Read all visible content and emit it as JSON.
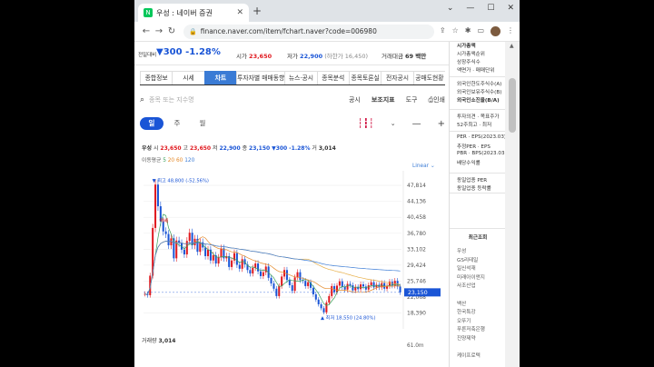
{
  "browser": {
    "tab_title": "우성 : 네이버 증권",
    "url": "finance.naver.com/item/fchart.naver?code=006980"
  },
  "price_bar": {
    "prev_label": "전일대비",
    "change": "▼300",
    "change_pct": "-1.28%",
    "open_label": "시가",
    "open": "23,650",
    "low_label": "저가",
    "low": "22,900",
    "low_limit": "(하한가 16,450)",
    "amount_label": "거래대금",
    "amount": "69 백만"
  },
  "tabs": [
    "종합정보",
    "시세",
    "차트",
    "투자자별 매매동향",
    "뉴스·공시",
    "종목분석",
    "종목토론실",
    "전자공시",
    "공매도현황"
  ],
  "active_tab": "차트",
  "search": {
    "placeholder": "종목 또는 지수명",
    "link_disclosure": "공시",
    "link_indicator": "보조지표",
    "link_tools": "도구",
    "link_print": "인쇄"
  },
  "periods": [
    "일",
    "주",
    "월"
  ],
  "active_period": "일",
  "ohlc": {
    "name": "우성",
    "open_label": "시",
    "open": "23,650",
    "high_label": "고",
    "high": "23,650",
    "low_label": "저",
    "low": "22,900",
    "close_label": "종",
    "close": "23,150",
    "change": "▼300",
    "pct": "-1.28%",
    "vol_label": "거",
    "vol": "3,014"
  },
  "moving_average": {
    "label": "이동평균",
    "v5": "5",
    "v20": "20",
    "v60": "60",
    "v120": "120"
  },
  "scale_label": "Linear",
  "volume_label": "거래량",
  "volume_value": "3,014",
  "volume_axis": "61.0m",
  "right_panel": {
    "items1": [
      "시가총액",
      "시가총액순위",
      "상장주식수",
      "액면가 · 매매단위"
    ],
    "items2": [
      "외국인한도주식수(A)",
      "외국인보유주식수(B)",
      "외국인소진율(B/A)"
    ],
    "items3": [
      "투자의견 · 목표주가",
      "52주최고 · 최저"
    ],
    "items4": [
      "PER · EPS(2023.03)",
      "추정PER · EPS",
      "PBR · BPS(2023.03)",
      "배당수익률"
    ],
    "items5": [
      "동일업종 PER",
      "동일업종 등락률"
    ],
    "recent_title": "최근조회",
    "recent": [
      "우성",
      "GS리테일",
      "일신석재",
      "미래아이앤지",
      "사조산업",
      "",
      "백산",
      "한국특강",
      "오뚜기",
      "푸른저축은행",
      "진양제약",
      "",
      "케이프로텍"
    ]
  },
  "chart_data": {
    "type": "candlestick",
    "title": "",
    "yaxis_ticks": [
      47814,
      44136,
      40458,
      36780,
      33102,
      29424,
      25746,
      22068,
      18390
    ],
    "current_price": 23150,
    "current_price_label": "23,150",
    "max_label": "최고 48,800 (-52.56%)",
    "min_label": "최저 18,550 (24.80%)",
    "ma_label": "역배",
    "ylim": [
      16000,
      49500
    ],
    "closes": [
      22800,
      22500,
      27000,
      38000,
      48000,
      43000,
      39500,
      37200,
      36600,
      34000,
      35600,
      31000,
      35100,
      34500,
      33000,
      31900,
      35000,
      36900,
      34000,
      35500,
      32500,
      34700,
      33500,
      31500,
      33000,
      30500,
      31700,
      29800,
      31200,
      33300,
      31000,
      31500,
      29000,
      30500,
      32200,
      29500,
      28600,
      30800,
      29600,
      28300,
      27500,
      28800,
      29800,
      28000,
      26900,
      27800,
      29100,
      26500,
      25200,
      24000,
      22300,
      24600,
      26800,
      28300,
      26000,
      24800,
      23500,
      26600,
      27800,
      26000,
      25800,
      24600,
      25500,
      24200,
      22700,
      21500,
      20400,
      19500,
      18550,
      20800,
      22300,
      24600,
      23200,
      24700,
      25700,
      24400,
      23800,
      25100,
      24800,
      23600,
      24400,
      23900,
      25000,
      24500,
      23800,
      24800,
      25500,
      24300,
      24900,
      24300,
      25300,
      24000,
      24600,
      25600,
      24700,
      25800,
      24500,
      23150
    ]
  }
}
